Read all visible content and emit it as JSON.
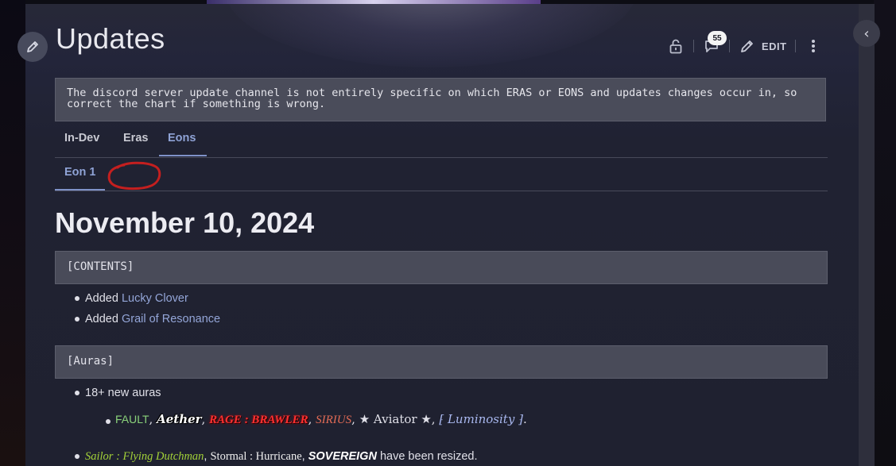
{
  "page": {
    "title": "Updates",
    "comment_count": "55",
    "edit_label": "EDIT"
  },
  "notice": "The discord server update channel is not entirely specific on which ERAS or EONS and updates changes occur in, so correct the chart if something is wrong.",
  "tabs": [
    {
      "label": "In-Dev",
      "active": false
    },
    {
      "label": "Eras",
      "active": false
    },
    {
      "label": "Eons",
      "active": true
    }
  ],
  "subtabs": [
    {
      "label": "Eon 1",
      "active": true
    }
  ],
  "content": {
    "date_heading": "November 10, 2024",
    "sections": {
      "contents": {
        "header": "[CONTENTS]",
        "items": [
          {
            "prefix": "Added ",
            "link": "Lucky Clover"
          },
          {
            "prefix": "Added ",
            "link": "Grail of Resonance"
          }
        ]
      },
      "auras": {
        "header": "[Auras]",
        "item": "18+ new auras",
        "aura_names": {
          "fault": "FAULT",
          "aether": "Aether",
          "rage": "RAGE : BRAWLER",
          "sirius": "SIRIUS",
          "aviator": "★ Aviator ★",
          "luminosity_open": "⁅ ",
          "luminosity": "Luminosity",
          "luminosity_close": " ⁆"
        },
        "resized": {
          "sailor": "Sailor : Flying Dutchman",
          "stormal": "Stormal : Hurricane",
          "sovereign": "SOVEREIGN",
          "suffix": " have been resized."
        }
      }
    }
  },
  "colors": {
    "panel_bg": "#202232",
    "link": "#94a6d8",
    "active_tab": "#8fa3d6",
    "annotation_red": "#c41f1f"
  }
}
